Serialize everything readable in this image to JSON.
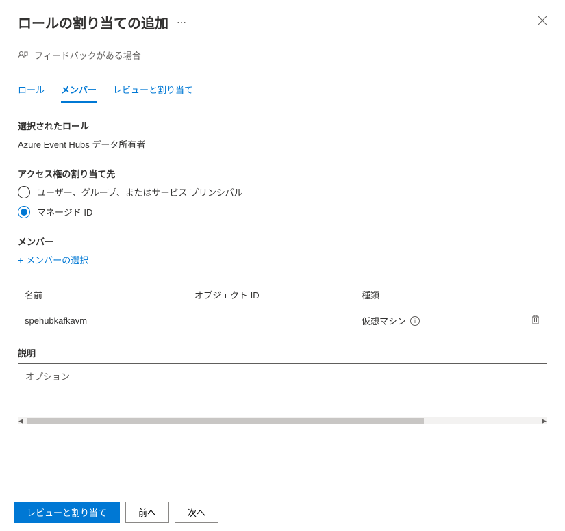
{
  "header": {
    "title": "ロールの割り当ての追加"
  },
  "feedback": {
    "text": "フィードバックがある場合"
  },
  "tabs": {
    "role": "ロール",
    "members": "メンバー",
    "review": "レビューと割り当て"
  },
  "selectedRole": {
    "label": "選択されたロール",
    "value": "Azure Event Hubs データ所有者"
  },
  "assignAccess": {
    "label": "アクセス権の割り当て先",
    "options": {
      "userGroup": "ユーザー、グループ、またはサービス プリンシパル",
      "managedId": "マネージド ID"
    }
  },
  "members": {
    "label": "メンバー",
    "selectLink": "メンバーの選択"
  },
  "table": {
    "headers": {
      "name": "名前",
      "objectId": "オブジェクト ID",
      "type": "種類"
    },
    "rows": [
      {
        "name": "spehubkafkavm",
        "objectId": "",
        "type": "仮想マシン"
      }
    ]
  },
  "description": {
    "label": "説明",
    "placeholder": "オプション"
  },
  "footer": {
    "review": "レビューと割り当て",
    "prev": "前へ",
    "next": "次へ"
  }
}
